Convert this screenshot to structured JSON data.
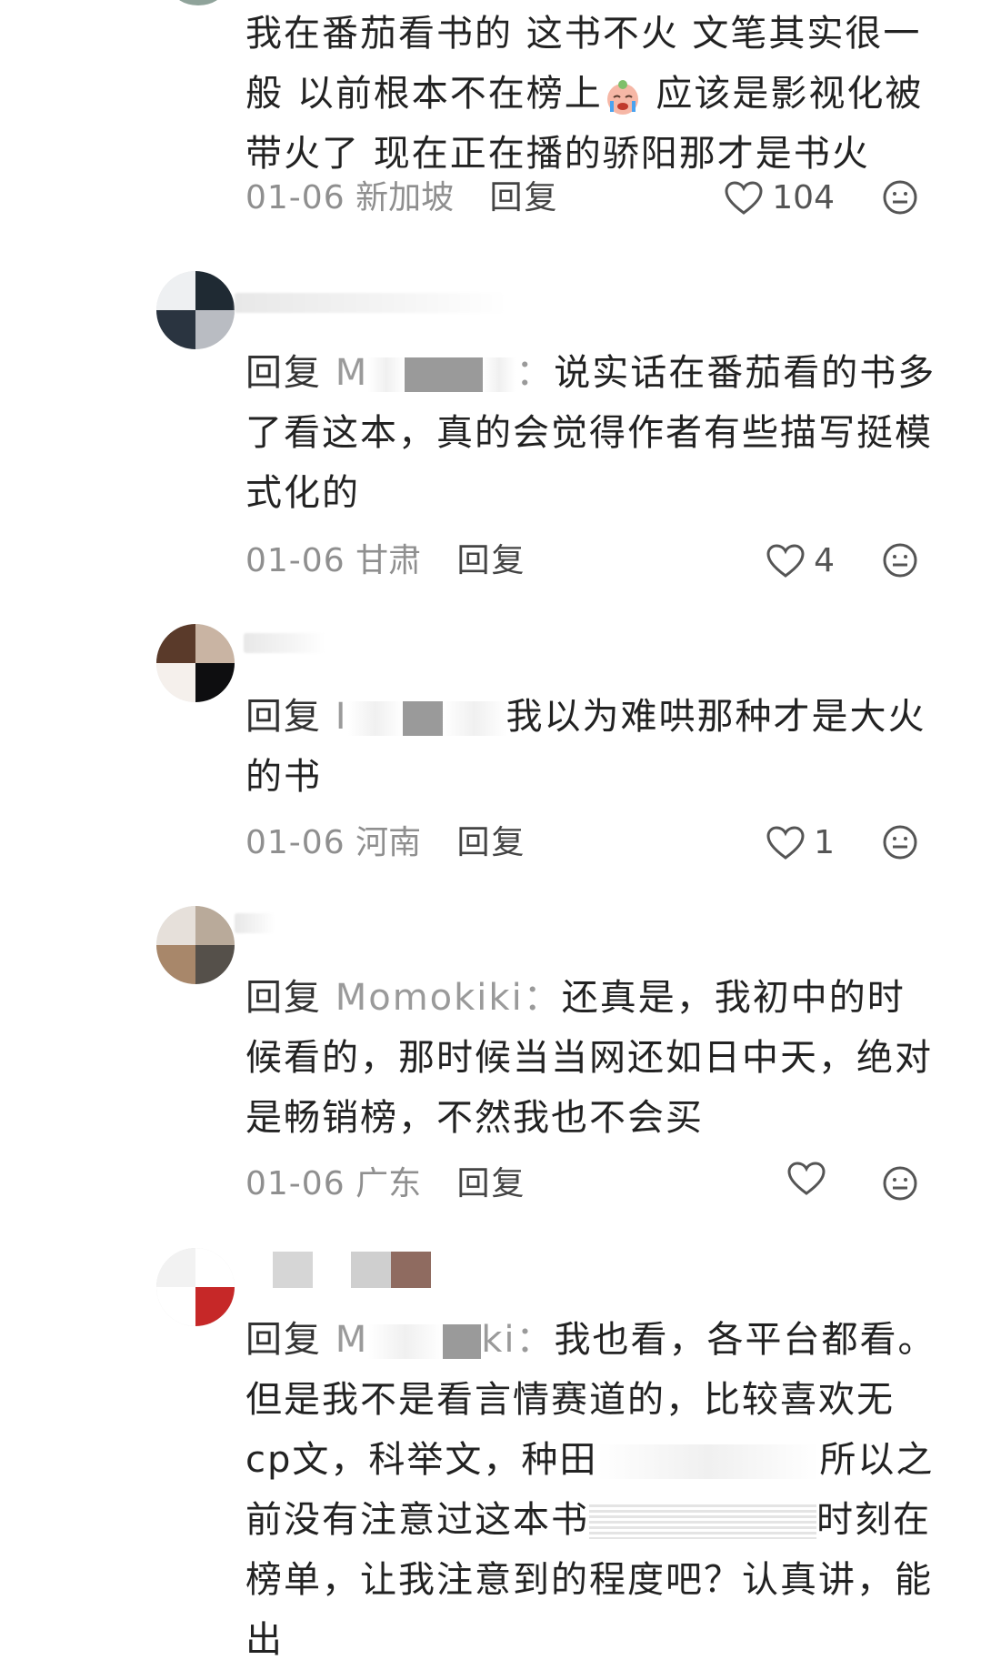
{
  "comments": [
    {
      "text": "我在番茄看书的 这书不火 文笔其实很一般 以前根本不在榜上",
      "text_tail": " 应该是影视化被带火了 现在正在播的骄阳那才是书火",
      "date": "01-06",
      "location": "新加坡",
      "reply_label": "回复",
      "likes": "104"
    },
    {
      "reply_prefix": "回复",
      "mention": "M",
      "colon": "：",
      "text": "说实话在番茄看的书多了看这本，真的会觉得作者有些描写挺模式化的",
      "date": "01-06",
      "location": "甘肃",
      "reply_label": "回复",
      "likes": "4"
    },
    {
      "reply_prefix": "回复",
      "mention": "I",
      "text": "我以为难哄那种才是大火的书",
      "date": "01-06",
      "location": "河南",
      "reply_label": "回复",
      "likes": "1"
    },
    {
      "reply_prefix": "回复",
      "mention": "Momokiki：",
      "text": "还真是，我初中的时候看的，那时候当当网还如日中天，绝对是畅销榜，不然我也不会买",
      "date": "01-06",
      "location": "广东",
      "reply_label": "回复",
      "likes": ""
    },
    {
      "reply_prefix": "回复",
      "mention": "M",
      "mention_tail": "ki：",
      "text_a": "我也看，各平台都看。但是我不是看言情赛道的，比较喜欢无cp文，科举文，种田",
      "text_b": "所以之前没有注意过这本书",
      "text_c": "时刻在榜单，让我注意到的程度吧？认真讲，能出"
    }
  ],
  "colors": {
    "mosaic": "#9a9a9a",
    "meta": "#8f8f8f",
    "text": "#222222"
  },
  "icons": [
    "heart-icon",
    "emoji-reaction-icon",
    "crying-emoji-icon"
  ]
}
